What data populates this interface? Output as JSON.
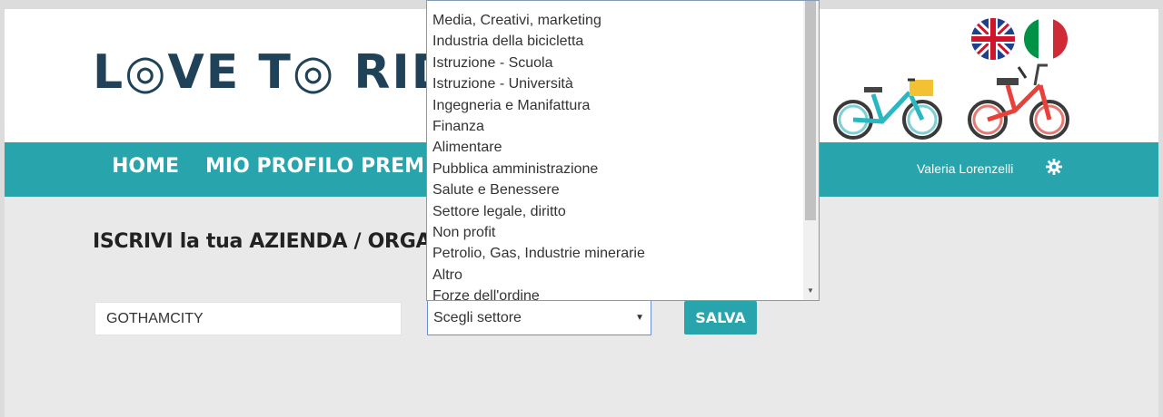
{
  "brand": {
    "logo_text": "L◎VE T◎ RIDE"
  },
  "nav": {
    "items": [
      "HOME",
      "MIO PROFILO",
      "PREMI"
    ],
    "user_name": "Valeria Lorenzelli"
  },
  "page": {
    "title": "ISCRIVI la tua AZIENDA / ORGANIZZ",
    "company_name_value": "GOTHAMCITY",
    "sector_select_value": "Scegli settore",
    "save_label": "SALVA"
  },
  "dropdown": {
    "options": [
      "Media, Creativi, marketing",
      "Industria della bicicletta",
      "Istruzione - Scuola",
      "Istruzione - Università",
      "Ingegneria e Manifattura",
      "Finanza",
      "Alimentare",
      "Pubblica amministrazione",
      "Salute e Benessere",
      "Settore legale, diritto",
      "Non profit",
      "Petrolio, Gas, Industrie minerarie",
      "Altro",
      "Forze dell'ordine"
    ]
  },
  "colors": {
    "accent": "#27a4ac",
    "logo": "#1f4258",
    "content_bg": "#e9e9e9"
  },
  "icons": [
    "uk-flag-icon",
    "italy-flag-icon",
    "bicycle-icon",
    "gear-icon",
    "chevron-down-icon"
  ]
}
